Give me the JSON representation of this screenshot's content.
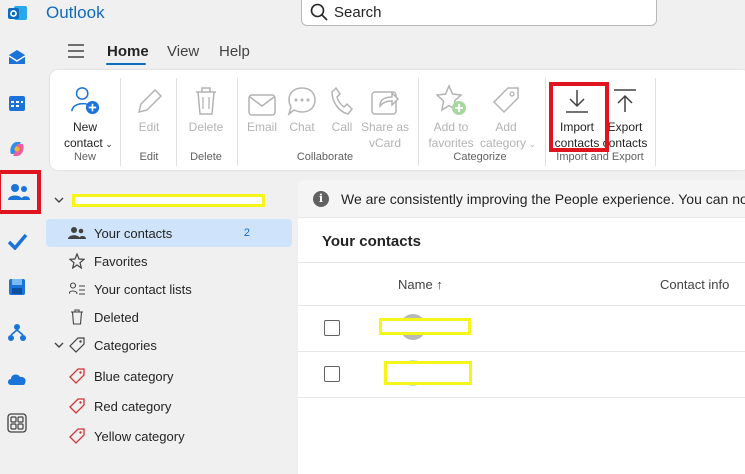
{
  "app": {
    "name": "Outlook"
  },
  "search": {
    "placeholder": "Search"
  },
  "menu_tabs": [
    {
      "label": "Home",
      "active": true
    },
    {
      "label": "View",
      "active": false
    },
    {
      "label": "Help",
      "active": false
    }
  ],
  "ribbon": {
    "new_contact": {
      "line1": "New",
      "line2": "contact"
    },
    "edit": "Edit",
    "delete": "Delete",
    "email": "Email",
    "chat": "Chat",
    "call": "Call",
    "share_vcard": {
      "line1": "Share as",
      "line2": "vCard"
    },
    "add_favorites": {
      "line1": "Add to",
      "line2": "favorites"
    },
    "add_category": {
      "line1": "Add",
      "line2": "category"
    },
    "import_contacts": {
      "line1": "Import",
      "line2": "contacts"
    },
    "export_contacts": {
      "line1": "Export",
      "line2": "contacts"
    },
    "groups": {
      "new": "New",
      "edit": "Edit",
      "delete": "Delete",
      "collaborate": "Collaborate",
      "categorize": "Categorize",
      "import_export": "Import and Export"
    }
  },
  "nav": {
    "items": [
      {
        "label": "Your contacts",
        "count": "2",
        "icon": "people-icon"
      },
      {
        "label": "Favorites",
        "icon": "star-icon"
      },
      {
        "label": "Your contact lists",
        "icon": "people-list-icon"
      },
      {
        "label": "Deleted",
        "icon": "trash-icon"
      },
      {
        "label": "Categories",
        "icon": "tag-icon"
      },
      {
        "label": "Blue category",
        "icon": "tag-icon"
      },
      {
        "label": "Red category",
        "icon": "tag-icon"
      },
      {
        "label": "Yellow category",
        "icon": "tag-icon"
      }
    ]
  },
  "main": {
    "banner": "We are consistently improving the People experience. You can now",
    "section_title": "Your contacts",
    "columns": {
      "name": "Name",
      "contact_info": "Contact info"
    },
    "sort_indicator": "↑"
  },
  "colors": {
    "accent": "#0f6cbd",
    "highlight_red": "#e0141e",
    "redaction_yellow": "#f5f51a",
    "selected_bg": "#cfe4fa",
    "category_tag": "#d13438"
  }
}
